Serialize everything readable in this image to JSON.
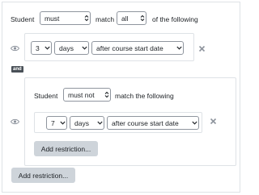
{
  "outer": {
    "student_label": "Student",
    "must_select": "must",
    "match_label": "match",
    "all_select": "all",
    "of_following_label": "of the following"
  },
  "rule1": {
    "number_select": "3",
    "unit_select": "days",
    "relative_select": "after course start date"
  },
  "and_badge": "and",
  "inner": {
    "student_label": "Student",
    "must_not_select": "must not",
    "match_following_label": "match the following",
    "rule": {
      "number_select": "7",
      "unit_select": "days",
      "relative_select": "after course start date"
    },
    "add_restriction_button": "Add restriction..."
  },
  "add_restriction_button": "Add restriction...",
  "colors": {
    "border": "#dee2e6",
    "button_bg": "#ced4da",
    "badge_bg": "#495057",
    "icon": "#8f959e"
  }
}
